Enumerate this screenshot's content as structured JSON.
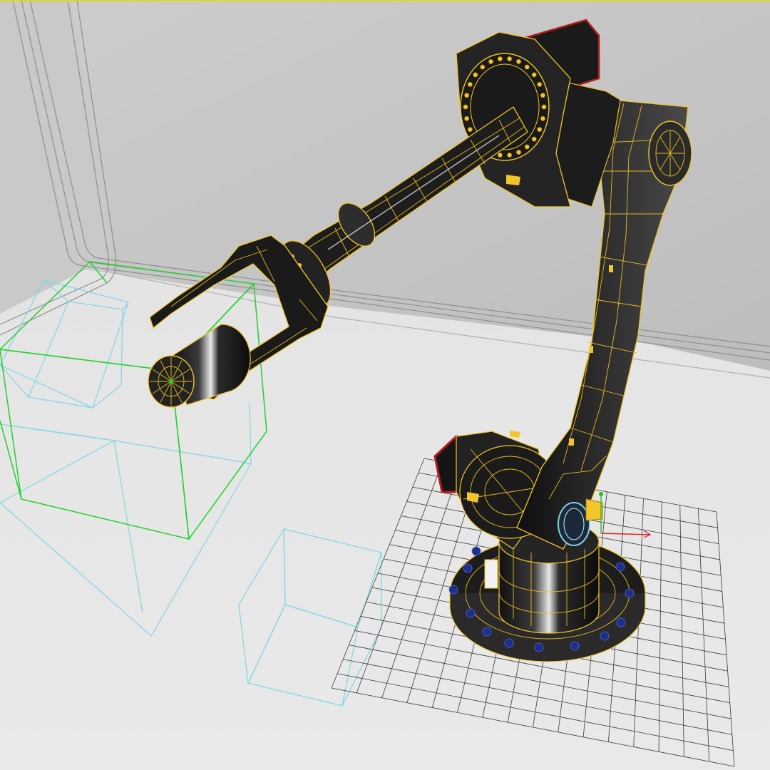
{
  "viewport": {
    "shading_mode": "wireframe-on-shaded",
    "colors": {
      "background_wall": "#c8c8c8",
      "floor": "#e2e2e2",
      "wire_selected": "#f2c62a",
      "mesh_body": "#1b1b1b",
      "bolt_heads": "#1c2f8c",
      "motor_caps": "#b01c1c",
      "box_wireframe": "#7fd6e6",
      "selected_box": "#22d12c",
      "construction_grid": "#3a3a3a",
      "gizmo_x_axis": "#e02020",
      "gizmo_y_axis": "#20c020"
    }
  },
  "scene_objects": [
    {
      "name": "robot-arm",
      "selected": true
    },
    {
      "name": "wire-box-selected",
      "selected": true
    },
    {
      "name": "wire-box"
    },
    {
      "name": "wire-box"
    },
    {
      "name": "wire-box"
    },
    {
      "name": "floor-grid"
    }
  ]
}
